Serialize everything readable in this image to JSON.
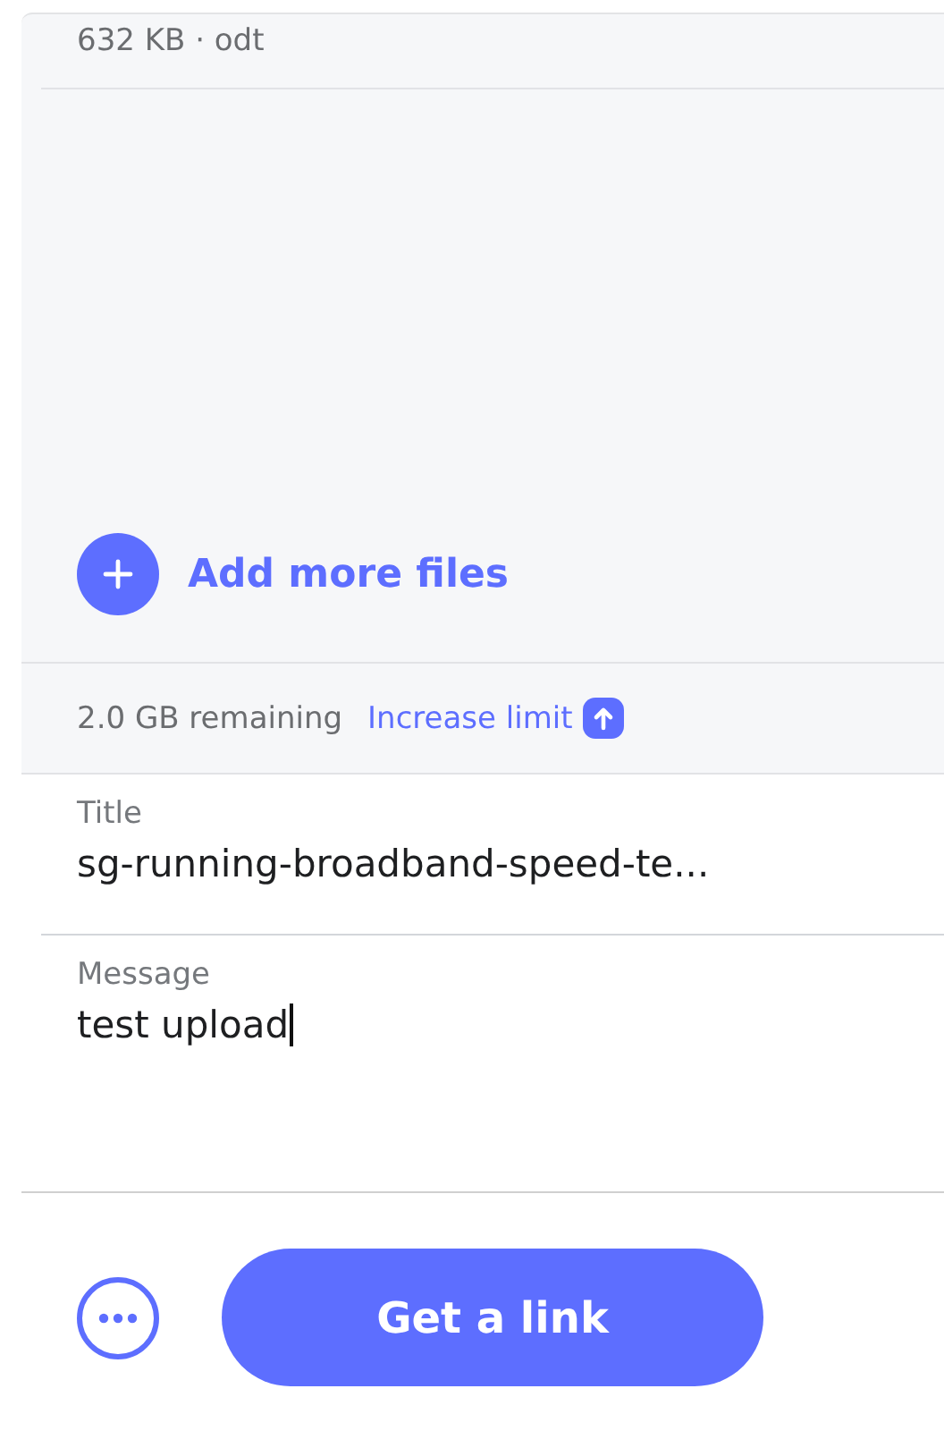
{
  "file": {
    "meta": "632 KB · odt"
  },
  "add_files": {
    "label": "Add more files"
  },
  "quota": {
    "remaining": "2.0 GB remaining",
    "link": "Increase limit"
  },
  "fields": [
    {
      "label": "Title",
      "value": "sg-running-broadband-speed-te...",
      "focused": false
    },
    {
      "label": "Message",
      "value": "test upload",
      "focused": true
    }
  ],
  "actions": {
    "primary": "Get a link"
  }
}
